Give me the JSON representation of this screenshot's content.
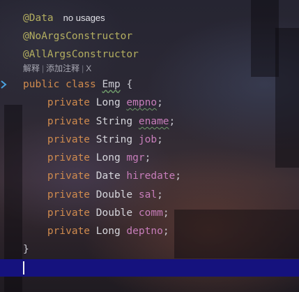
{
  "code": {
    "ann_data": "@Data",
    "no_usages": "no usages",
    "ann_noargs": "@NoArgsConstructor",
    "ann_allargs": "@AllArgsConstructor",
    "hint": {
      "text1": "解释",
      "sep1": "|",
      "text2": "添加注释",
      "sep2": "|",
      "close": "X"
    },
    "class_line": {
      "kw1": "public",
      "kw2": "class",
      "name": "Emp",
      "brace": "{"
    },
    "fields": [
      {
        "mod": "private",
        "type": "Long",
        "name": "empno",
        "semi": ";"
      },
      {
        "mod": "private",
        "type": "String",
        "name": "ename",
        "semi": ";"
      },
      {
        "mod": "private",
        "type": "String",
        "name": "job",
        "semi": ";"
      },
      {
        "mod": "private",
        "type": "Long",
        "name": "mgr",
        "semi": ";"
      },
      {
        "mod": "private",
        "type": "Date",
        "name": "hiredate",
        "semi": ";"
      },
      {
        "mod": "private",
        "type": "Double",
        "name": "sal",
        "semi": ";"
      },
      {
        "mod": "private",
        "type": "Double",
        "name": "comm",
        "semi": ";"
      },
      {
        "mod": "private",
        "type": "Long",
        "name": "deptno",
        "semi": ";"
      }
    ],
    "close_brace": "}"
  },
  "colors": {
    "annotation": "#b3ae60",
    "keyword": "#d08b4e",
    "field": "#c77dba",
    "current_line": "#15127e",
    "gutter_icon": "#4aa3df"
  },
  "icons": {
    "gutter": "implementation-chevron-icon"
  }
}
